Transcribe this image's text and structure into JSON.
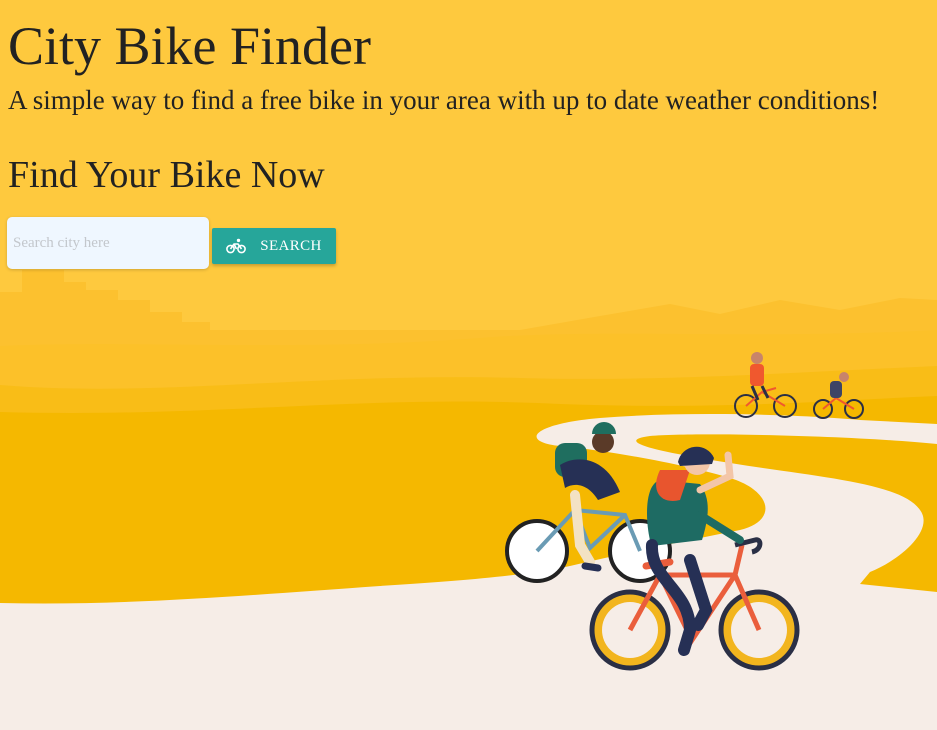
{
  "header": {
    "title": "City Bike Finder",
    "subtitle": "A simple way to find a free bike in your area with up to date weather conditions!"
  },
  "search": {
    "heading": "Find Your Bike Now",
    "placeholder": "Search city here",
    "value": "",
    "button_label": "SEARCH",
    "button_icon": "bike-icon"
  },
  "colors": {
    "background": "#fec93e",
    "button": "#26a69a",
    "input_bg": "#eff7ff",
    "road": "#f6ede7"
  }
}
